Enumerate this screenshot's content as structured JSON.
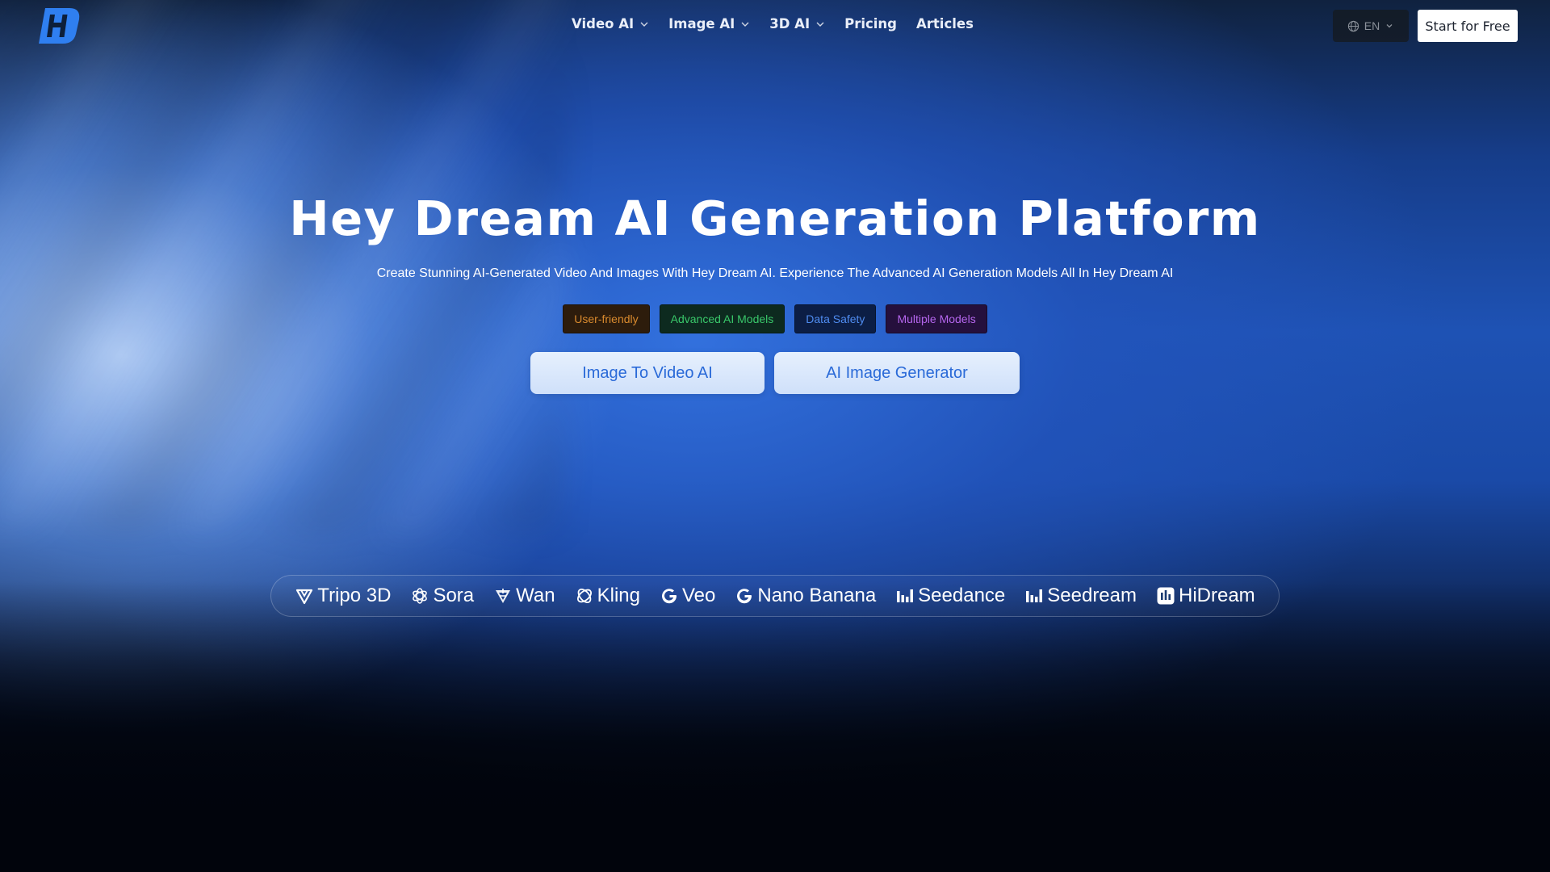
{
  "header": {
    "logo_icon": "hey-dream-logo",
    "nav": [
      {
        "label": "Video AI",
        "has_dropdown": true
      },
      {
        "label": "Image AI",
        "has_dropdown": true
      },
      {
        "label": "3D AI",
        "has_dropdown": true
      },
      {
        "label": "Pricing",
        "has_dropdown": false
      },
      {
        "label": "Articles",
        "has_dropdown": false
      }
    ],
    "language": {
      "icon": "globe-icon",
      "value": "EN"
    },
    "start_button": "Start for Free"
  },
  "hero": {
    "title": "Hey Dream AI Generation Platform",
    "subtitle": "Create Stunning AI-Generated Video And Images With Hey Dream AI. Experience The Advanced AI Generation Models All In Hey Dream AI",
    "tags": [
      {
        "label": "User-friendly",
        "color": "#d98a2e",
        "bg": "#2d1c0c"
      },
      {
        "label": "Advanced AI Models",
        "color": "#39c76a",
        "bg": "#0d2a1f"
      },
      {
        "label": "Data Safety",
        "color": "#4f8cf0",
        "bg": "#0c1e45"
      },
      {
        "label": "Multiple Models",
        "color": "#b566ee",
        "bg": "#25103d"
      }
    ],
    "buttons": [
      {
        "label": "Image To Video AI"
      },
      {
        "label": "AI Image Generator"
      }
    ]
  },
  "models": [
    {
      "name": "Tripo 3D",
      "icon": "tripo-icon"
    },
    {
      "name": "Sora",
      "icon": "openai-icon"
    },
    {
      "name": "Wan",
      "icon": "wan-icon"
    },
    {
      "name": "Kling",
      "icon": "kling-icon"
    },
    {
      "name": "Veo",
      "icon": "google-icon"
    },
    {
      "name": "Nano Banana",
      "icon": "google-icon"
    },
    {
      "name": "Seedance",
      "icon": "bytedance-icon"
    },
    {
      "name": "Seedream",
      "icon": "bytedance-icon"
    },
    {
      "name": "HiDream",
      "icon": "hidream-icon"
    }
  ],
  "colors": {
    "accent_blue": "#2a6ad8",
    "logo_blue": "#2f7ff0"
  }
}
